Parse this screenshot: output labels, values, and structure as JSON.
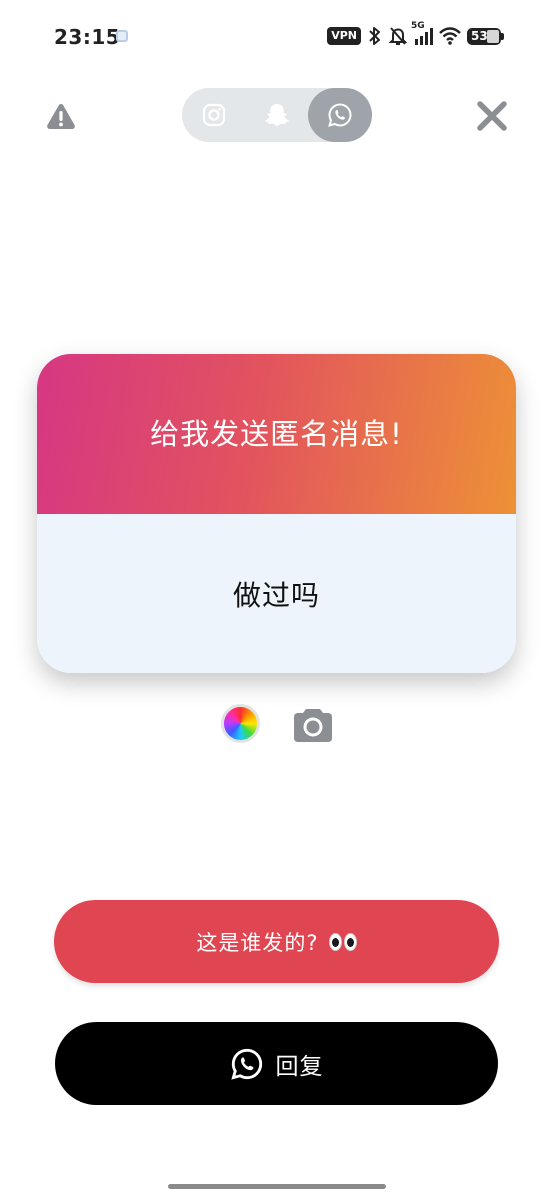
{
  "status_bar": {
    "time": "23:15",
    "vpn": "VPN",
    "network": "5G",
    "battery": "53"
  },
  "top_bar": {
    "icons": [
      "warning-icon",
      "instagram-icon",
      "snapchat-icon",
      "whatsapp-icon",
      "close-icon"
    ],
    "active_tab": "whatsapp"
  },
  "card": {
    "title": "给我发送匿名消息!",
    "question": "做过吗",
    "gradient_colors": [
      "#d63783",
      "#e2535e",
      "#ed9136"
    ],
    "body_color": "#eef4fb"
  },
  "tools": {
    "icons": [
      "color-wheel-icon",
      "camera-icon"
    ]
  },
  "who_button": {
    "label": "这是谁发的?",
    "color": "#e04552"
  },
  "reply_button": {
    "label": "回复",
    "color": "#000000"
  }
}
